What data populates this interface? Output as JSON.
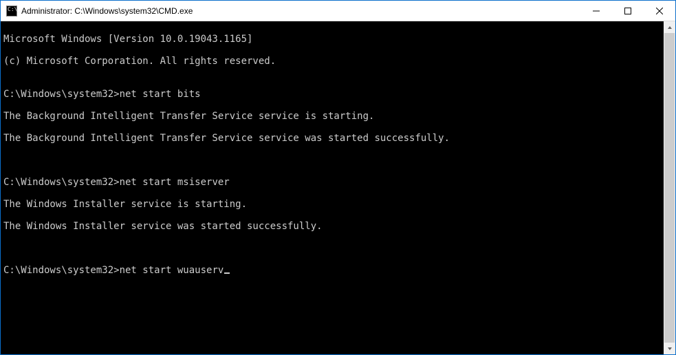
{
  "window": {
    "title": "Administrator: C:\\Windows\\system32\\CMD.exe"
  },
  "terminal": {
    "header1": "Microsoft Windows [Version 10.0.19043.1165]",
    "header2": "(c) Microsoft Corporation. All rights reserved.",
    "blank": "",
    "prompt": "C:\\Windows\\system32>",
    "blocks": [
      {
        "cmd": "net start bits",
        "out1": "The Background Intelligent Transfer Service service is starting.",
        "out2": "The Background Intelligent Transfer Service service was started successfully."
      },
      {
        "cmd": "net start msiserver",
        "out1": "The Windows Installer service is starting.",
        "out2": "The Windows Installer service was started successfully."
      }
    ],
    "current_cmd": "net start wuauserv"
  }
}
